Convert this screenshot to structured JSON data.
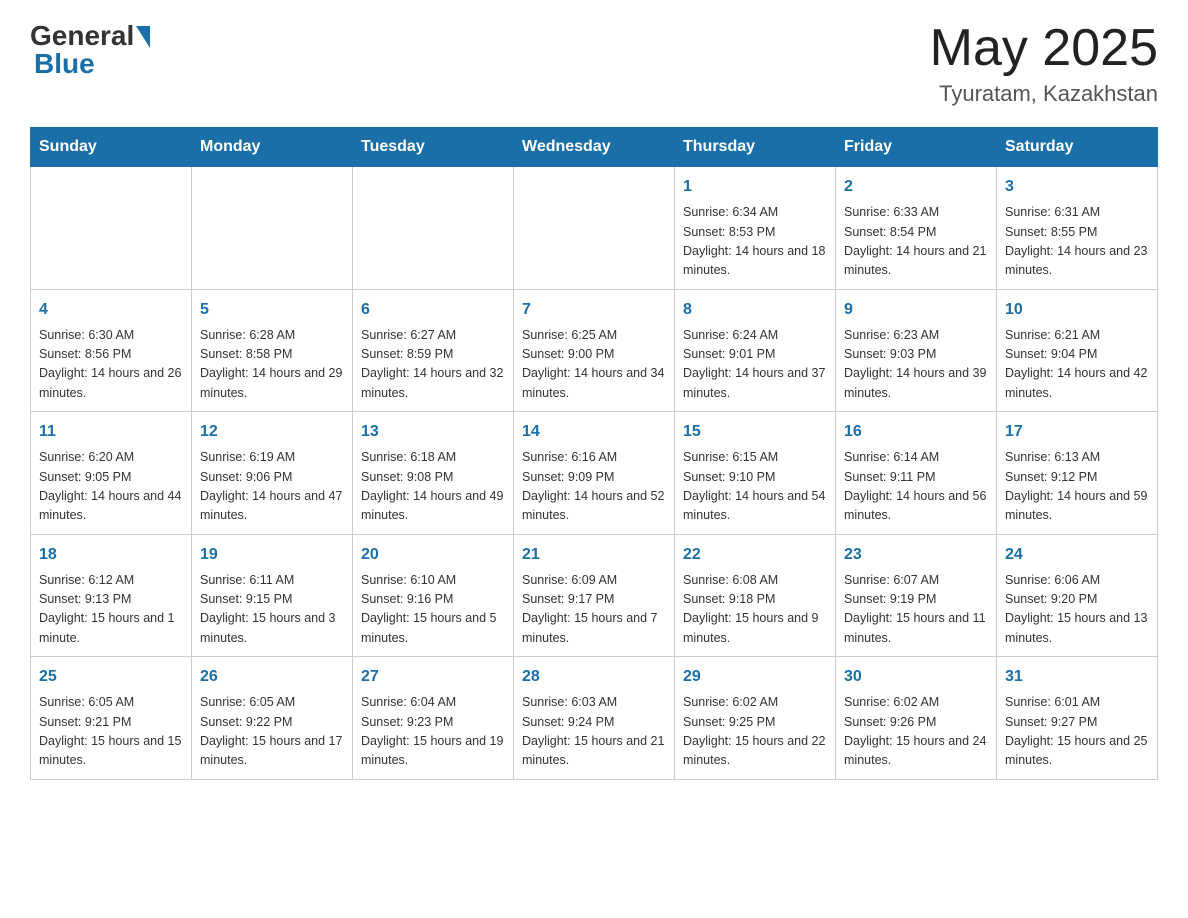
{
  "header": {
    "title": "May 2025",
    "subtitle": "Tyuratam, Kazakhstan",
    "logo_general": "General",
    "logo_blue": "Blue"
  },
  "days_of_week": [
    "Sunday",
    "Monday",
    "Tuesday",
    "Wednesday",
    "Thursday",
    "Friday",
    "Saturday"
  ],
  "weeks": [
    {
      "days": [
        {
          "num": "",
          "info": ""
        },
        {
          "num": "",
          "info": ""
        },
        {
          "num": "",
          "info": ""
        },
        {
          "num": "",
          "info": ""
        },
        {
          "num": "1",
          "info": "Sunrise: 6:34 AM\nSunset: 8:53 PM\nDaylight: 14 hours and 18 minutes."
        },
        {
          "num": "2",
          "info": "Sunrise: 6:33 AM\nSunset: 8:54 PM\nDaylight: 14 hours and 21 minutes."
        },
        {
          "num": "3",
          "info": "Sunrise: 6:31 AM\nSunset: 8:55 PM\nDaylight: 14 hours and 23 minutes."
        }
      ]
    },
    {
      "days": [
        {
          "num": "4",
          "info": "Sunrise: 6:30 AM\nSunset: 8:56 PM\nDaylight: 14 hours and 26 minutes."
        },
        {
          "num": "5",
          "info": "Sunrise: 6:28 AM\nSunset: 8:58 PM\nDaylight: 14 hours and 29 minutes."
        },
        {
          "num": "6",
          "info": "Sunrise: 6:27 AM\nSunset: 8:59 PM\nDaylight: 14 hours and 32 minutes."
        },
        {
          "num": "7",
          "info": "Sunrise: 6:25 AM\nSunset: 9:00 PM\nDaylight: 14 hours and 34 minutes."
        },
        {
          "num": "8",
          "info": "Sunrise: 6:24 AM\nSunset: 9:01 PM\nDaylight: 14 hours and 37 minutes."
        },
        {
          "num": "9",
          "info": "Sunrise: 6:23 AM\nSunset: 9:03 PM\nDaylight: 14 hours and 39 minutes."
        },
        {
          "num": "10",
          "info": "Sunrise: 6:21 AM\nSunset: 9:04 PM\nDaylight: 14 hours and 42 minutes."
        }
      ]
    },
    {
      "days": [
        {
          "num": "11",
          "info": "Sunrise: 6:20 AM\nSunset: 9:05 PM\nDaylight: 14 hours and 44 minutes."
        },
        {
          "num": "12",
          "info": "Sunrise: 6:19 AM\nSunset: 9:06 PM\nDaylight: 14 hours and 47 minutes."
        },
        {
          "num": "13",
          "info": "Sunrise: 6:18 AM\nSunset: 9:08 PM\nDaylight: 14 hours and 49 minutes."
        },
        {
          "num": "14",
          "info": "Sunrise: 6:16 AM\nSunset: 9:09 PM\nDaylight: 14 hours and 52 minutes."
        },
        {
          "num": "15",
          "info": "Sunrise: 6:15 AM\nSunset: 9:10 PM\nDaylight: 14 hours and 54 minutes."
        },
        {
          "num": "16",
          "info": "Sunrise: 6:14 AM\nSunset: 9:11 PM\nDaylight: 14 hours and 56 minutes."
        },
        {
          "num": "17",
          "info": "Sunrise: 6:13 AM\nSunset: 9:12 PM\nDaylight: 14 hours and 59 minutes."
        }
      ]
    },
    {
      "days": [
        {
          "num": "18",
          "info": "Sunrise: 6:12 AM\nSunset: 9:13 PM\nDaylight: 15 hours and 1 minute."
        },
        {
          "num": "19",
          "info": "Sunrise: 6:11 AM\nSunset: 9:15 PM\nDaylight: 15 hours and 3 minutes."
        },
        {
          "num": "20",
          "info": "Sunrise: 6:10 AM\nSunset: 9:16 PM\nDaylight: 15 hours and 5 minutes."
        },
        {
          "num": "21",
          "info": "Sunrise: 6:09 AM\nSunset: 9:17 PM\nDaylight: 15 hours and 7 minutes."
        },
        {
          "num": "22",
          "info": "Sunrise: 6:08 AM\nSunset: 9:18 PM\nDaylight: 15 hours and 9 minutes."
        },
        {
          "num": "23",
          "info": "Sunrise: 6:07 AM\nSunset: 9:19 PM\nDaylight: 15 hours and 11 minutes."
        },
        {
          "num": "24",
          "info": "Sunrise: 6:06 AM\nSunset: 9:20 PM\nDaylight: 15 hours and 13 minutes."
        }
      ]
    },
    {
      "days": [
        {
          "num": "25",
          "info": "Sunrise: 6:05 AM\nSunset: 9:21 PM\nDaylight: 15 hours and 15 minutes."
        },
        {
          "num": "26",
          "info": "Sunrise: 6:05 AM\nSunset: 9:22 PM\nDaylight: 15 hours and 17 minutes."
        },
        {
          "num": "27",
          "info": "Sunrise: 6:04 AM\nSunset: 9:23 PM\nDaylight: 15 hours and 19 minutes."
        },
        {
          "num": "28",
          "info": "Sunrise: 6:03 AM\nSunset: 9:24 PM\nDaylight: 15 hours and 21 minutes."
        },
        {
          "num": "29",
          "info": "Sunrise: 6:02 AM\nSunset: 9:25 PM\nDaylight: 15 hours and 22 minutes."
        },
        {
          "num": "30",
          "info": "Sunrise: 6:02 AM\nSunset: 9:26 PM\nDaylight: 15 hours and 24 minutes."
        },
        {
          "num": "31",
          "info": "Sunrise: 6:01 AM\nSunset: 9:27 PM\nDaylight: 15 hours and 25 minutes."
        }
      ]
    }
  ]
}
